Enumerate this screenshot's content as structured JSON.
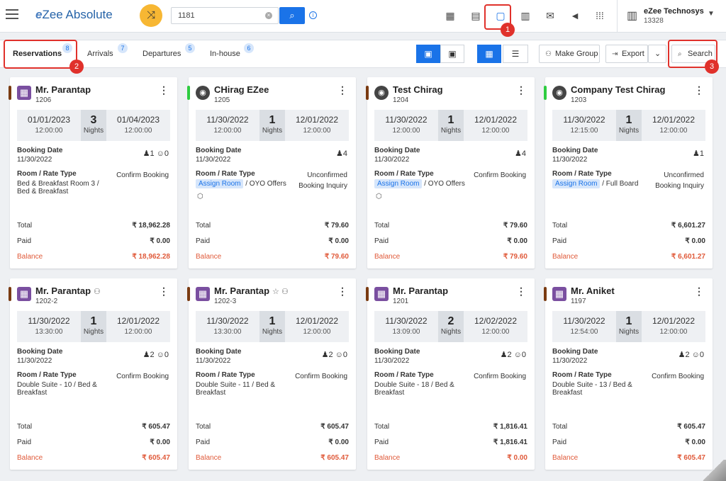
{
  "app": {
    "title_e": "e",
    "title_rest": "Zee Absolute"
  },
  "search": {
    "value": "1181"
  },
  "user": {
    "name": "eZee Technosys",
    "code": "13328"
  },
  "callouts": [
    "1",
    "2",
    "3"
  ],
  "tabs": [
    {
      "label": "Reservations",
      "count": "8"
    },
    {
      "label": "Arrivals",
      "count": "7"
    },
    {
      "label": "Departures",
      "count": "5"
    },
    {
      "label": "In-house",
      "count": "6"
    }
  ],
  "actions": {
    "make_group": "Make Group",
    "export": "Export",
    "search": "Search"
  },
  "labels": {
    "booking_date": "Booking Date",
    "room_rate": "Room / Rate Type",
    "total": "Total",
    "paid": "Paid",
    "balance": "Balance",
    "nights": "Nights"
  },
  "cards": [
    {
      "name": "Mr. Parantap",
      "id": "1206",
      "icon": "building",
      "strip": "#7a3b12",
      "ext": "",
      "arr_date": "01/01/2023",
      "arr_time": "12:00:00",
      "nights": "3",
      "dep_date": "01/04/2023",
      "dep_time": "12:00:00",
      "booking_date": "11/30/2022",
      "adults": "1",
      "children": "0",
      "status": "Confirm Booking",
      "room": "Bed & Breakfast Room 3 / Bed & Breakfast",
      "assign": "",
      "rate": "",
      "source": "",
      "cube": "",
      "total": "₹ 18,962.28",
      "paid": "₹ 0.00",
      "balance": "₹ 18,962.28"
    },
    {
      "name": "CHirag EZee",
      "id": "1205",
      "icon": "globe",
      "strip": "#2ecc40",
      "ext": "",
      "arr_date": "11/30/2022",
      "arr_time": "12:00:00",
      "nights": "1",
      "dep_date": "12/01/2022",
      "dep_time": "12:00:00",
      "booking_date": "11/30/2022",
      "adults": "4",
      "children": "",
      "status": "Unconfirmed",
      "room": "",
      "assign": "Assign Room",
      "rate": " / OYO Offers",
      "source": "Booking Inquiry",
      "cube": "⬡",
      "total": "₹ 79.60",
      "paid": "₹ 0.00",
      "balance": "₹ 79.60"
    },
    {
      "name": "Test Chirag",
      "id": "1204",
      "icon": "globe",
      "strip": "#7a3b12",
      "ext": "",
      "arr_date": "11/30/2022",
      "arr_time": "12:00:00",
      "nights": "1",
      "dep_date": "12/01/2022",
      "dep_time": "12:00:00",
      "booking_date": "11/30/2022",
      "adults": "4",
      "children": "",
      "status": "Confirm Booking",
      "room": "",
      "assign": "Assign Room",
      "rate": " / OYO Offers",
      "source": "",
      "cube": "⬡",
      "total": "₹ 79.60",
      "paid": "₹ 0.00",
      "balance": "₹ 79.60"
    },
    {
      "name": "Company Test Chirag",
      "id": "1203",
      "icon": "globe",
      "strip": "#2ecc40",
      "ext": "",
      "arr_date": "11/30/2022",
      "arr_time": "12:15:00",
      "nights": "1",
      "dep_date": "12/01/2022",
      "dep_time": "12:00:00",
      "booking_date": "11/30/2022",
      "adults": "1",
      "children": "",
      "status": "Unconfirmed",
      "room": "",
      "assign": "Assign Room",
      "rate": " / Full Board",
      "source": "Booking Inquiry",
      "cube": "",
      "total": "₹ 6,601.27",
      "paid": "₹ 0.00",
      "balance": "₹ 6,601.27"
    },
    {
      "name": "Mr. Parantap",
      "id": "1202-2",
      "icon": "building",
      "strip": "#7a3b12",
      "ext": "⚇",
      "arr_date": "11/30/2022",
      "arr_time": "13:30:00",
      "nights": "1",
      "dep_date": "12/01/2022",
      "dep_time": "12:00:00",
      "booking_date": "11/30/2022",
      "adults": "2",
      "children": "0",
      "status": "Confirm Booking",
      "room": "Double Suite - 10 / Bed & Breakfast",
      "assign": "",
      "rate": "",
      "source": "",
      "cube": "",
      "total": "₹ 605.47",
      "paid": "₹ 0.00",
      "balance": "₹ 605.47"
    },
    {
      "name": "Mr. Parantap",
      "id": "1202-3",
      "icon": "building",
      "strip": "#7a3b12",
      "ext": "☆ ⚇",
      "arr_date": "11/30/2022",
      "arr_time": "13:30:00",
      "nights": "1",
      "dep_date": "12/01/2022",
      "dep_time": "12:00:00",
      "booking_date": "11/30/2022",
      "adults": "2",
      "children": "0",
      "status": "Confirm Booking",
      "room": "Double Suite - 11 / Bed & Breakfast",
      "assign": "",
      "rate": "",
      "source": "",
      "cube": "",
      "total": "₹ 605.47",
      "paid": "₹ 0.00",
      "balance": "₹ 605.47"
    },
    {
      "name": "Mr. Parantap",
      "id": "1201",
      "icon": "building",
      "strip": "#7a3b12",
      "ext": "",
      "arr_date": "11/30/2022",
      "arr_time": "13:09:00",
      "nights": "2",
      "dep_date": "12/02/2022",
      "dep_time": "12:00:00",
      "booking_date": "11/30/2022",
      "adults": "2",
      "children": "0",
      "status": "Confirm Booking",
      "room": "Double Suite - 18 / Bed & Breakfast",
      "assign": "",
      "rate": "",
      "source": "",
      "cube": "",
      "total": "₹ 1,816.41",
      "paid": "₹ 1,816.41",
      "balance": "₹ 0.00"
    },
    {
      "name": "Mr. Aniket",
      "id": "1197",
      "icon": "building",
      "strip": "#7a3b12",
      "ext": "",
      "arr_date": "11/30/2022",
      "arr_time": "12:54:00",
      "nights": "1",
      "dep_date": "12/01/2022",
      "dep_time": "12:00:00",
      "booking_date": "11/30/2022",
      "adults": "2",
      "children": "0",
      "status": "Confirm Booking",
      "room": "Double Suite - 13 / Bed & Breakfast",
      "assign": "",
      "rate": "",
      "source": "",
      "cube": "",
      "total": "₹ 605.47",
      "paid": "₹ 0.00",
      "balance": "₹ 605.47"
    }
  ]
}
